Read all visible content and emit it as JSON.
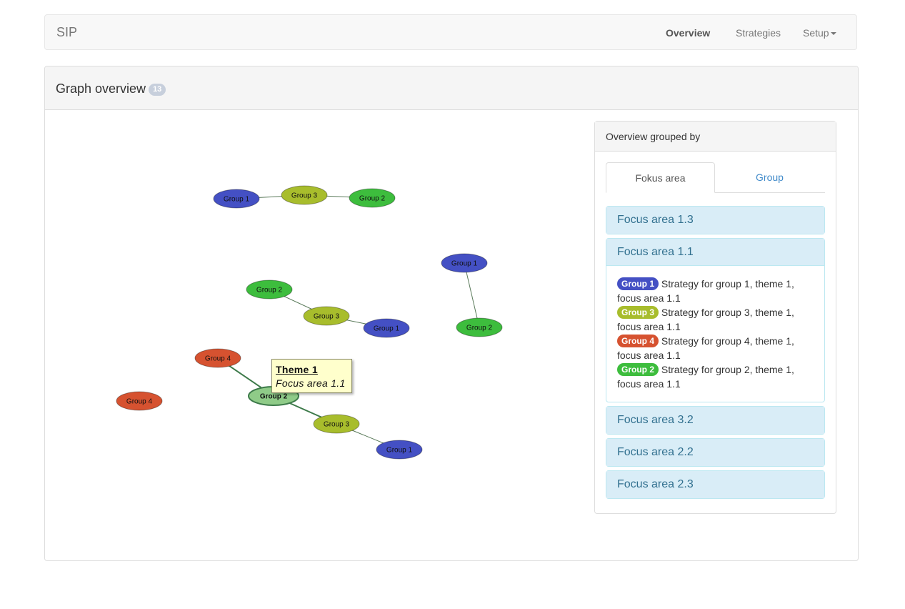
{
  "navbar": {
    "brand": "SIP",
    "items": [
      {
        "label": "Overview",
        "active": true
      },
      {
        "label": "Strategies",
        "active": false
      },
      {
        "label": "Setup",
        "active": false
      }
    ]
  },
  "panel": {
    "title": "Graph overview",
    "badge": "13"
  },
  "graph": {
    "nodes": [
      {
        "id": "a1",
        "label": "Group 1",
        "group": 1
      },
      {
        "id": "a3",
        "label": "Group 3",
        "group": 3
      },
      {
        "id": "a2",
        "label": "Group 2",
        "group": 2
      },
      {
        "id": "b1",
        "label": "Group 1",
        "group": 1
      },
      {
        "id": "b2",
        "label": "Group 2",
        "group": 2
      },
      {
        "id": "c2",
        "label": "Group 2",
        "group": 2
      },
      {
        "id": "c3",
        "label": "Group 3",
        "group": 3
      },
      {
        "id": "c1",
        "label": "Group 1",
        "group": 1
      },
      {
        "id": "d4",
        "label": "Group 4",
        "group": 4
      },
      {
        "id": "e4",
        "label": "Group 4",
        "group": 4
      },
      {
        "id": "d2",
        "label": "Group 2",
        "group": 2,
        "highlighted": true
      },
      {
        "id": "d3",
        "label": "Group 3",
        "group": 3
      },
      {
        "id": "d1",
        "label": "Group 1",
        "group": 1
      }
    ],
    "edges": [
      [
        "a1",
        "a3"
      ],
      [
        "a3",
        "a2"
      ],
      [
        "b1",
        "b2"
      ],
      [
        "c2",
        "c3"
      ],
      [
        "c3",
        "c1"
      ],
      [
        "d4",
        "d2"
      ],
      [
        "d2",
        "d3"
      ],
      [
        "d3",
        "d1"
      ]
    ],
    "tooltip": {
      "title": "Theme 1",
      "subtitle": "Focus area 1.1"
    }
  },
  "colors": {
    "group1": "#4450c4",
    "group2": "#3dbd3d",
    "group3": "#a8bd2c",
    "group4": "#d65230",
    "highlight": "#8fcb88"
  },
  "sidebar": {
    "heading": "Overview grouped by",
    "tabs": [
      {
        "label": "Fokus area",
        "active": true
      },
      {
        "label": "Group",
        "active": false
      }
    ],
    "accordion": [
      {
        "title": "Focus area 1.3",
        "open": false
      },
      {
        "title": "Focus area 1.1",
        "open": true,
        "items": [
          {
            "badge": "Group 1",
            "group": 1,
            "text": "Strategy for group 1, theme 1, focus area 1.1"
          },
          {
            "badge": "Group 3",
            "group": 3,
            "text": "Strategy for group 3, theme 1, focus area 1.1"
          },
          {
            "badge": "Group 4",
            "group": 4,
            "text": "Strategy for group 4, theme 1, focus area 1.1"
          },
          {
            "badge": "Group 2",
            "group": 2,
            "text": "Strategy for group 2, theme 1, focus area 1.1"
          }
        ]
      },
      {
        "title": "Focus area 3.2",
        "open": false
      },
      {
        "title": "Focus area 2.2",
        "open": false
      },
      {
        "title": "Focus area 2.3",
        "open": false
      }
    ]
  }
}
